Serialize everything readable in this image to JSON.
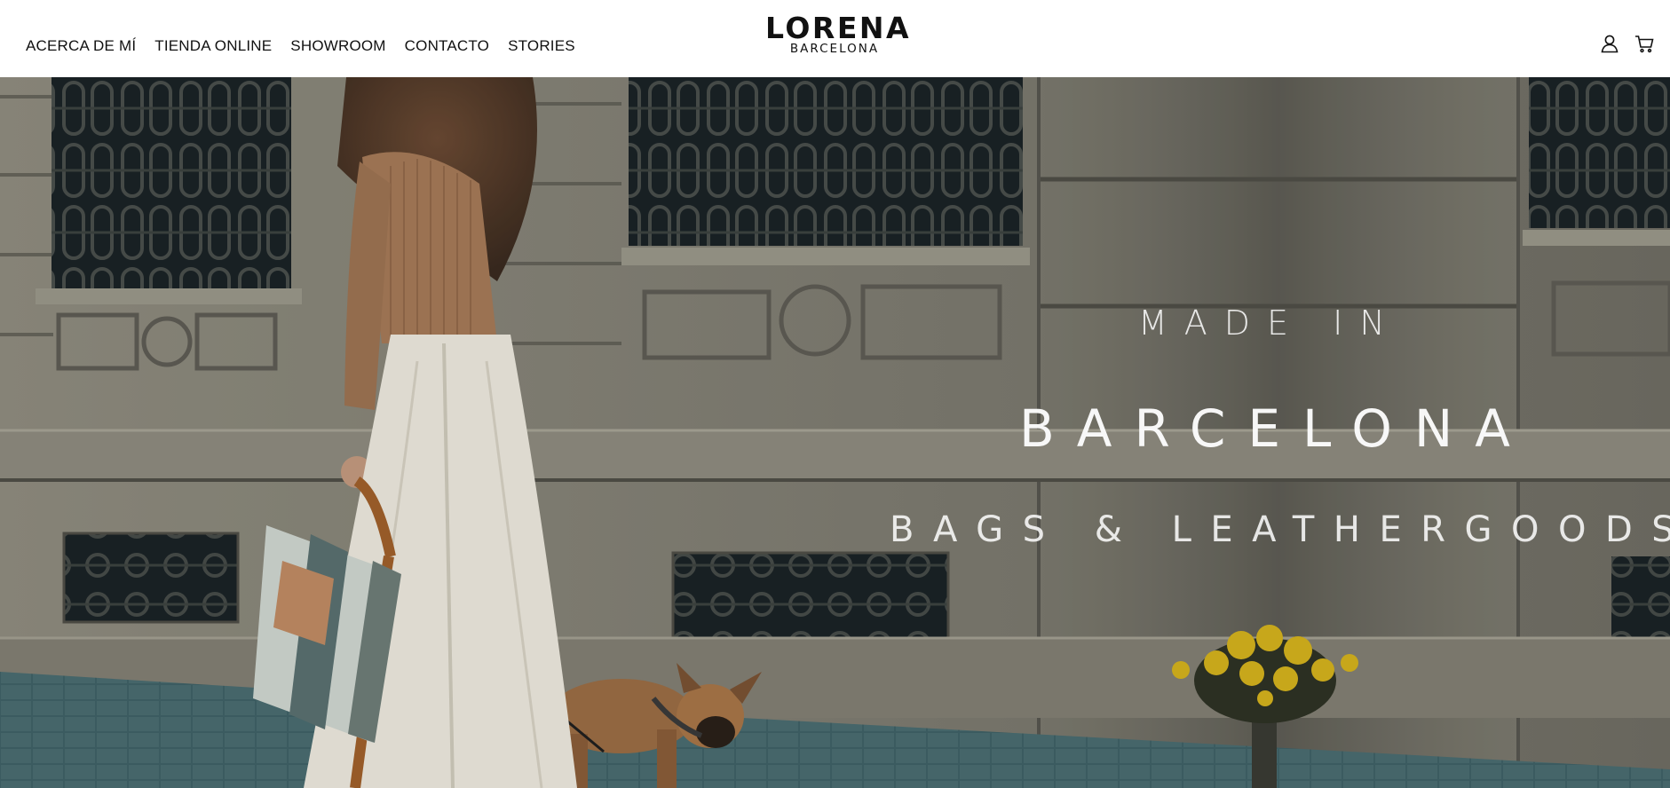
{
  "header": {
    "nav": [
      {
        "label": "ACERCA DE MÍ"
      },
      {
        "label": "TIENDA ONLINE"
      },
      {
        "label": "SHOWROOM"
      },
      {
        "label": "CONTACTO"
      },
      {
        "label": "STORIES"
      }
    ],
    "logo": {
      "main": "LORENA",
      "sub": "BARCELONA"
    },
    "icons": [
      "user-icon",
      "cart-icon"
    ]
  },
  "hero": {
    "line1": "MADE IN",
    "line2": "BARCELONA",
    "line3": "BAGS & LEATHERGOODS",
    "overlay_text_color": "#ffffff"
  },
  "colors": {
    "header_bg": "#ffffff",
    "nav_text": "#111111",
    "stone": "#8a8779",
    "ironwork": "#1d2327",
    "sweater": "#a57a58",
    "trousers": "#ece8dd",
    "pavement": "#3f6166"
  }
}
